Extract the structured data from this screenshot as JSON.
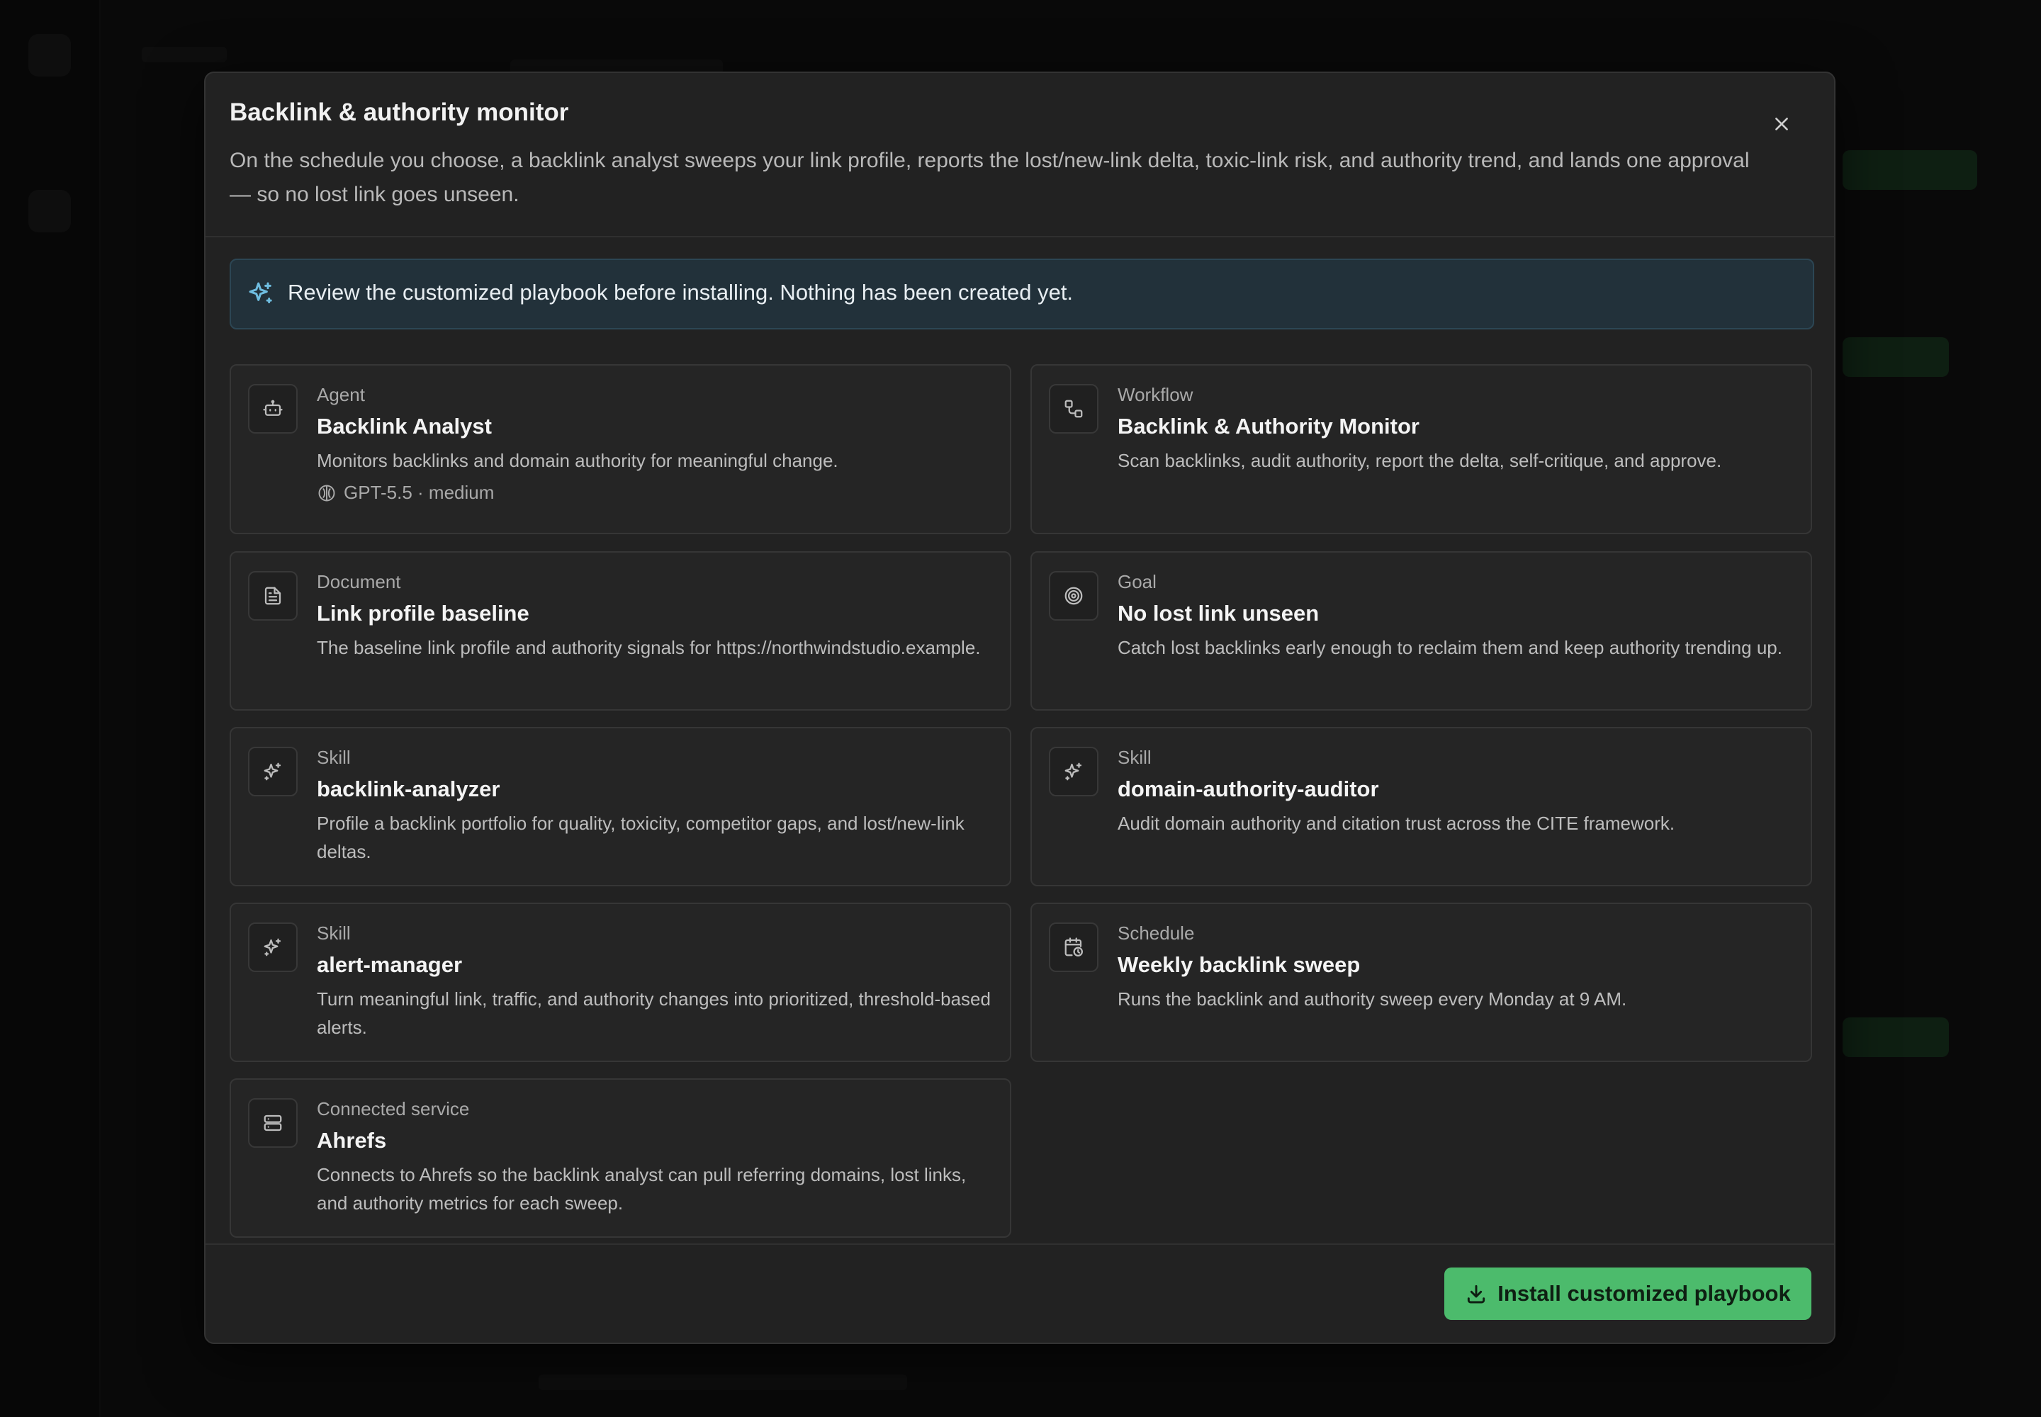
{
  "dialog": {
    "title": "Backlink & authority monitor",
    "description": "On the schedule you choose, a backlink analyst sweeps your link profile, reports the lost/new-link delta, toxic-link risk, and authority trend, and lands one approval — so no lost link goes unseen.",
    "close_icon": "close-icon"
  },
  "notice": {
    "icon": "sparkles-icon",
    "text": "Review the customized playbook before installing. Nothing has been created yet.",
    "color": "#22313a"
  },
  "cards": [
    {
      "icon": "bot-icon",
      "type": "Agent",
      "name": "Backlink Analyst",
      "desc": "Monitors backlinks and domain authority for meaningful change.",
      "meta": "GPT-5.5 · medium",
      "meta_icon": "model-icon"
    },
    {
      "icon": "workflow-icon",
      "type": "Workflow",
      "name": "Backlink & Authority Monitor",
      "desc": "Scan backlinks, audit authority, report the delta, self-critique, and approve."
    },
    {
      "icon": "document-icon",
      "type": "Document",
      "name": "Link profile baseline",
      "desc": "The baseline link profile and authority signals for https://northwindstudio.example."
    },
    {
      "icon": "target-icon",
      "type": "Goal",
      "name": "No lost link unseen",
      "desc": "Catch lost backlinks early enough to reclaim them and keep authority trending up."
    },
    {
      "icon": "sparkles-icon",
      "type": "Skill",
      "name": "backlink-analyzer",
      "desc": "Profile a backlink portfolio for quality, toxicity, competitor gaps, and lost/new-link deltas."
    },
    {
      "icon": "sparkles-icon",
      "type": "Skill",
      "name": "domain-authority-auditor",
      "desc": "Audit domain authority and citation trust across the CITE framework."
    },
    {
      "icon": "sparkles-icon",
      "type": "Skill",
      "name": "alert-manager",
      "desc": "Turn meaningful link, traffic, and authority changes into prioritized, threshold-based alerts."
    },
    {
      "icon": "calendar-clock-icon",
      "type": "Schedule",
      "name": "Weekly backlink sweep",
      "desc": "Runs the backlink and authority sweep every Monday at 9 AM."
    },
    {
      "icon": "server-icon",
      "type": "Connected service",
      "name": "Ahrefs",
      "desc": "Connects to Ahrefs so the backlink analyst can pull referring domains, lost links, and authority metrics for each sweep."
    }
  ],
  "footer": {
    "install_label": "Install customized playbook",
    "install_icon": "download-icon",
    "accent": "#4cbb6c"
  }
}
